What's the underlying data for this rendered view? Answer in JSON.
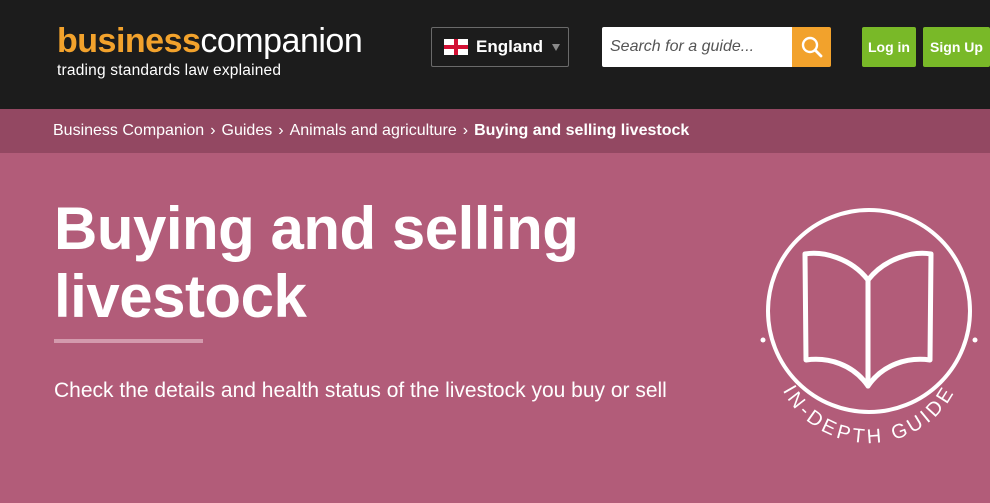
{
  "header": {
    "logo": {
      "bold": "business",
      "light": "companion",
      "tagline": "trading standards law explained"
    },
    "region": {
      "label": "England",
      "icon": "england-flag-icon"
    },
    "search": {
      "placeholder": "Search for a guide...",
      "icon": "search-icon"
    },
    "login_label": "Log in",
    "signup_label": "Sign Up"
  },
  "breadcrumb": {
    "items": [
      "Business Companion",
      "Guides",
      "Animals and agriculture"
    ],
    "separator": "›",
    "current": "Buying and selling livestock"
  },
  "hero": {
    "title": "Buying and selling livestock",
    "summary": "Check the details and health status of the livestock you buy or sell",
    "badge_text": "IN-DEPTH GUIDE",
    "badge_icon": "open-book-icon"
  },
  "colors": {
    "header_bg": "#1c1c1c",
    "brand_orange": "#f2a22c",
    "button_green": "#79b928",
    "breadcrumb_bg": "#934862",
    "hero_bg": "#b25c79"
  }
}
